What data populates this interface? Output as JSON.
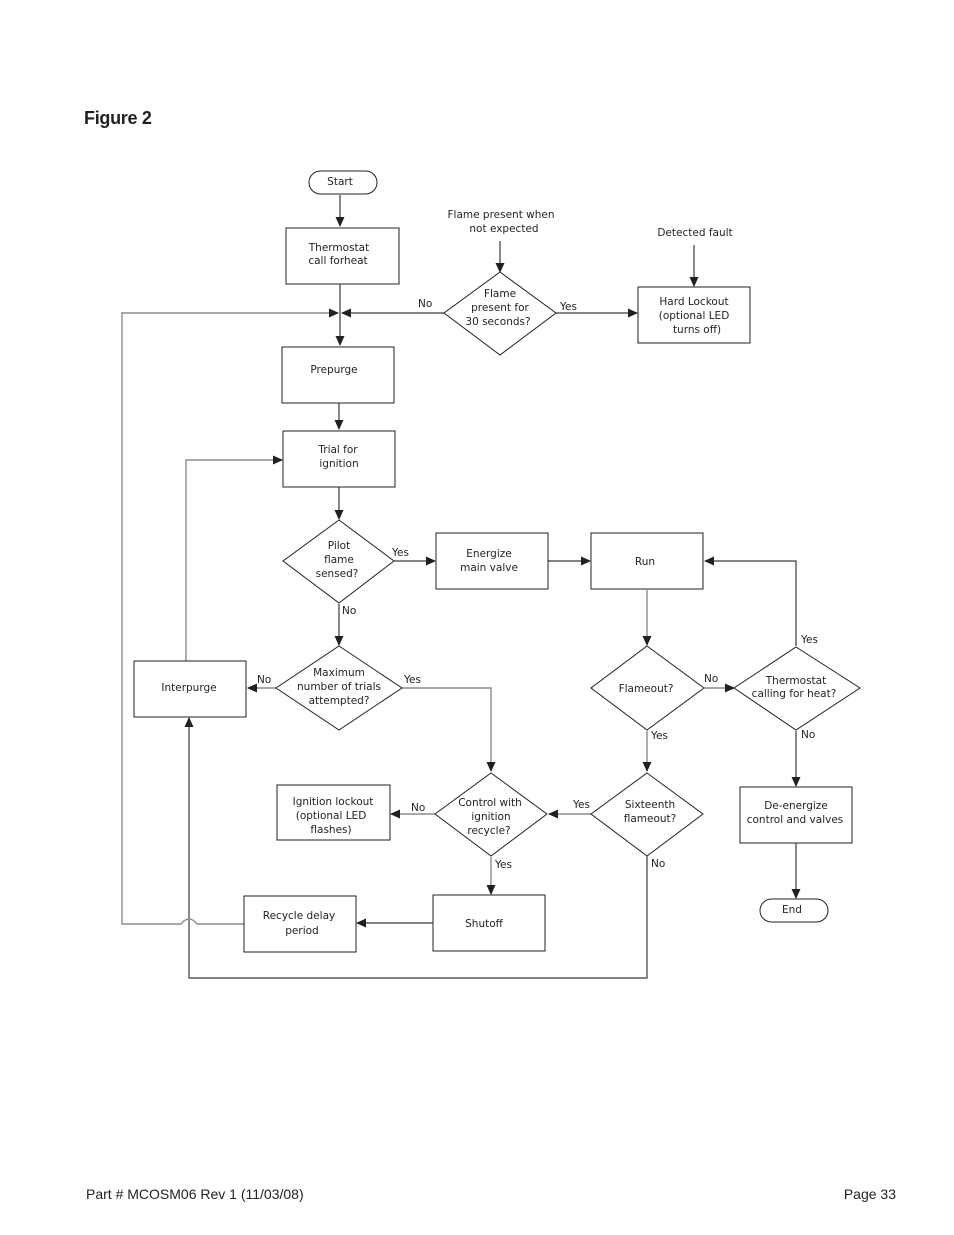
{
  "figure": {
    "title": "Figure 2"
  },
  "footer": {
    "part_number": "Part # MCOSM06 Rev 1 (11/03/08)",
    "page": "Page 33"
  },
  "nodes": {
    "start": {
      "type": "terminal",
      "lines": [
        "Start"
      ]
    },
    "thermostat_call": {
      "type": "process",
      "lines": [
        "Thermostat",
        "call forheat"
      ]
    },
    "flame_when_not_expected": {
      "type": "input",
      "lines": [
        "Flame present when",
        "not expected"
      ]
    },
    "flame_30s": {
      "type": "decision",
      "lines": [
        "Flame",
        "present for",
        "30 seconds?"
      ]
    },
    "detected_fault": {
      "type": "input",
      "lines": [
        "Detected fault"
      ]
    },
    "hard_lockout": {
      "type": "process",
      "lines": [
        "Hard Lockout",
        "(optional LED",
        "turns off)"
      ]
    },
    "prepurge": {
      "type": "process",
      "lines": [
        "Prepurge"
      ]
    },
    "trial_ignition": {
      "type": "process",
      "lines": [
        "Trial for",
        "ignition"
      ]
    },
    "pilot_sensed": {
      "type": "decision",
      "lines": [
        "Pilot",
        "flame",
        "sensed?"
      ]
    },
    "energize_valve": {
      "type": "process",
      "lines": [
        "Energize",
        "main valve"
      ]
    },
    "run": {
      "type": "process",
      "lines": [
        "Run"
      ]
    },
    "max_trials": {
      "type": "decision",
      "lines": [
        "Maximum",
        "number of trials",
        "attempted?"
      ]
    },
    "interpurge": {
      "type": "process",
      "lines": [
        "Interpurge"
      ]
    },
    "flameout": {
      "type": "decision",
      "lines": [
        "Flameout?"
      ]
    },
    "thermostat_calling": {
      "type": "decision",
      "lines": [
        "Thermostat",
        "calling for heat?"
      ]
    },
    "ignition_lockout": {
      "type": "process",
      "lines": [
        "Ignition lockout",
        "(optional LED",
        "flashes)"
      ]
    },
    "ignition_recycle": {
      "type": "decision",
      "lines": [
        "Control with",
        "ignition",
        "recycle?"
      ]
    },
    "sixteenth_flameout": {
      "type": "decision",
      "lines": [
        "Sixteenth",
        "flameout?"
      ]
    },
    "deenergize": {
      "type": "process",
      "lines": [
        "De-energize",
        "control and valves"
      ]
    },
    "recycle_delay": {
      "type": "process",
      "lines": [
        "Recycle delay",
        "period"
      ]
    },
    "shutoff": {
      "type": "process",
      "lines": [
        "Shutoff"
      ]
    },
    "end": {
      "type": "terminal",
      "lines": [
        "End"
      ]
    }
  },
  "edges": [
    {
      "from": "start",
      "to": "thermostat_call",
      "label": ""
    },
    {
      "from": "thermostat_call",
      "to": "prepurge",
      "label": ""
    },
    {
      "from": "flame_when_not_expected",
      "to": "flame_30s",
      "label": ""
    },
    {
      "from": "flame_30s",
      "to": "prepurge",
      "label": "No"
    },
    {
      "from": "flame_30s",
      "to": "hard_lockout",
      "label": "Yes"
    },
    {
      "from": "detected_fault",
      "to": "hard_lockout",
      "label": ""
    },
    {
      "from": "prepurge",
      "to": "trial_ignition",
      "label": ""
    },
    {
      "from": "trial_ignition",
      "to": "pilot_sensed",
      "label": ""
    },
    {
      "from": "pilot_sensed",
      "to": "energize_valve",
      "label": "Yes"
    },
    {
      "from": "pilot_sensed",
      "to": "max_trials",
      "label": "No"
    },
    {
      "from": "energize_valve",
      "to": "run",
      "label": ""
    },
    {
      "from": "max_trials",
      "to": "interpurge",
      "label": "No"
    },
    {
      "from": "max_trials",
      "to": "ignition_recycle",
      "label": "Yes"
    },
    {
      "from": "interpurge",
      "to": "trial_ignition",
      "label": ""
    },
    {
      "from": "run",
      "to": "flameout",
      "label": ""
    },
    {
      "from": "flameout",
      "to": "thermostat_calling",
      "label": "No"
    },
    {
      "from": "flameout",
      "to": "sixteenth_flameout",
      "label": "Yes"
    },
    {
      "from": "thermostat_calling",
      "to": "run",
      "label": "Yes"
    },
    {
      "from": "thermostat_calling",
      "to": "deenergize",
      "label": "No"
    },
    {
      "from": "sixteenth_flameout",
      "to": "ignition_recycle",
      "label": "Yes"
    },
    {
      "from": "sixteenth_flameout",
      "to": "interpurge",
      "label": "No"
    },
    {
      "from": "ignition_recycle",
      "to": "ignition_lockout",
      "label": "No"
    },
    {
      "from": "ignition_recycle",
      "to": "shutoff",
      "label": "Yes"
    },
    {
      "from": "shutoff",
      "to": "recycle_delay",
      "label": ""
    },
    {
      "from": "recycle_delay",
      "to": "prepurge",
      "label": ""
    },
    {
      "from": "deenergize",
      "to": "end",
      "label": ""
    }
  ],
  "labels": {
    "yes": "Yes",
    "no": "No"
  }
}
